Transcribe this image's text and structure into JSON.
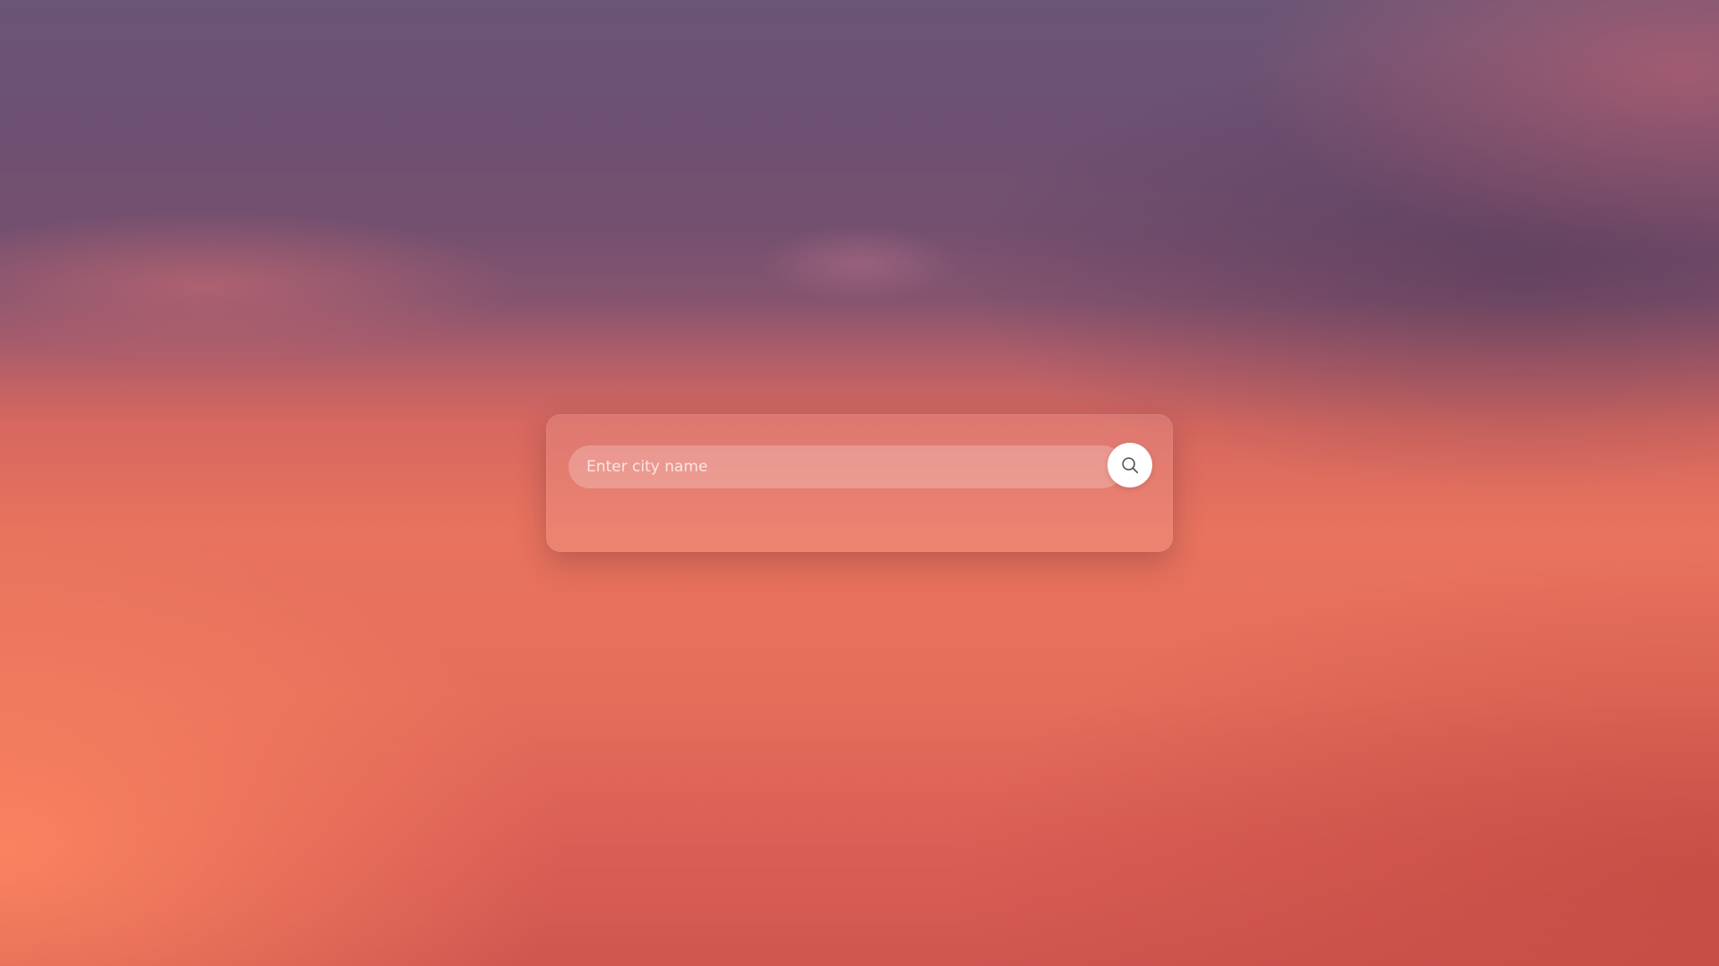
{
  "search": {
    "placeholder": "Enter city name",
    "value": ""
  },
  "icons": {
    "search_button": "search-icon"
  },
  "colors": {
    "button_background": "#ffffff",
    "icon_stroke": "#555555"
  }
}
